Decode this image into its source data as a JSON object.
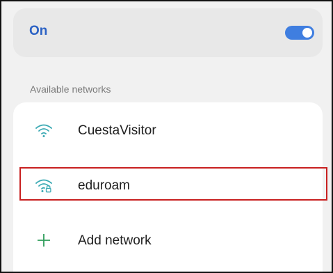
{
  "wifi": {
    "state_label": "On",
    "enabled": true
  },
  "available_networks": {
    "heading": "Available networks",
    "items": [
      {
        "name": "CuestaVisitor",
        "icon": "wifi-signal-icon",
        "secured": false
      },
      {
        "name": "eduroam",
        "icon": "wifi-lock-icon",
        "secured": true,
        "highlighted": true
      }
    ],
    "add_network_label": "Add network",
    "add_icon": "plus-icon"
  },
  "colors": {
    "accent": "#2c62c4",
    "toggle_on": "#3f7ee0",
    "network_icon": "#3aa9b3",
    "plus_icon": "#2e9d5a",
    "highlight": "#c81f1f"
  }
}
